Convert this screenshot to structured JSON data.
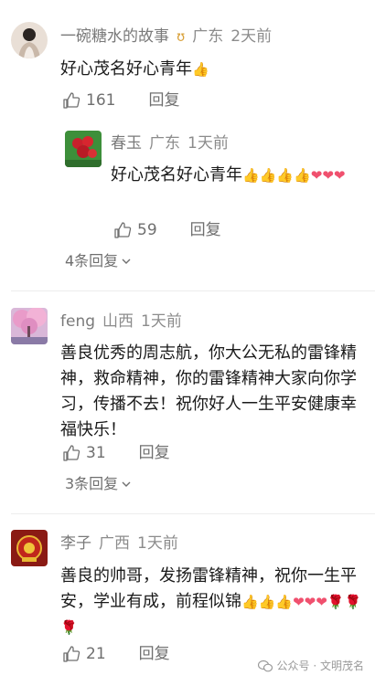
{
  "comments": [
    {
      "user": "一碗糖水的故事",
      "location": "广东",
      "time": "2天前",
      "text": "好心茂名好心青年",
      "likes": "161",
      "reply_label": "回复",
      "more_replies": "4条回复",
      "reply": {
        "user": "春玉",
        "location": "广东",
        "time": "1天前",
        "text": "好心茂名好心青年",
        "likes": "59",
        "reply_label": "回复"
      }
    },
    {
      "user": "feng",
      "location": "山西",
      "time": "1天前",
      "text": "善良优秀的周志航，你大公无私的雷锋精神，救命精神，你的雷锋精神大家向你学习，传播不去！祝你好人一生平安健康幸福快乐！",
      "likes": "31",
      "reply_label": "回复",
      "more_replies": "3条回复"
    },
    {
      "user": "李子",
      "location": "广西",
      "time": "1天前",
      "text": "善良的帅哥，发扬雷锋精神，祝你一生平安，学业有成，前程似锦",
      "likes": "21",
      "reply_label": "回复"
    }
  ],
  "watermark": "公众号 · 文明茂名",
  "icons": {
    "like": "thumbs-up-outline-icon",
    "thumb_emoji": "thumbs-up-emoji-icon",
    "heart_emoji": "heart-emoji-icon",
    "rose_emoji": "rose-emoji-icon",
    "badge": "badge-icon",
    "chevron": "chevron-down-icon"
  },
  "colors": {
    "meta": "#8c8c8c",
    "text": "#1a1a1a",
    "action": "#6f6f6f"
  }
}
